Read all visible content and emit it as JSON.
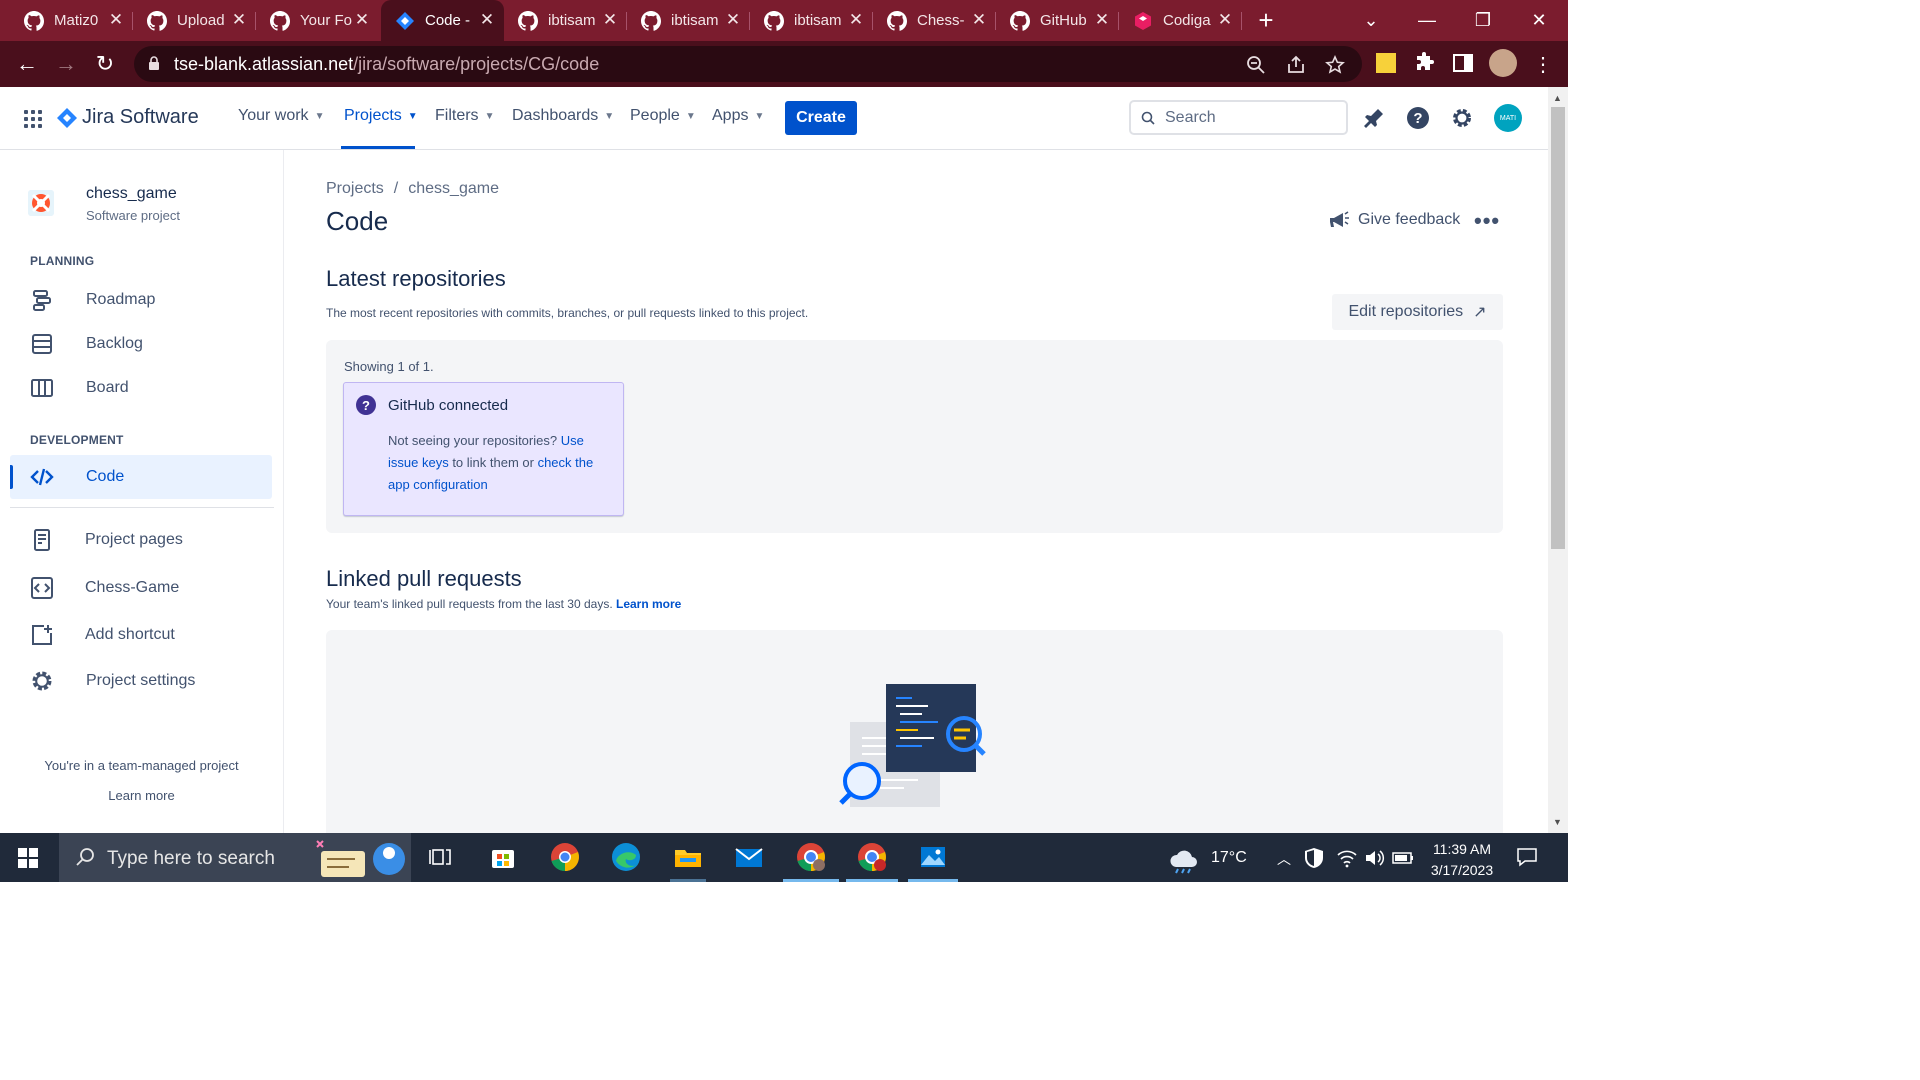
{
  "browser": {
    "tabs": [
      {
        "label": "Matiz0",
        "icon": "github-icon",
        "active": false
      },
      {
        "label": "Upload",
        "icon": "github-icon",
        "active": false
      },
      {
        "label": "Your Fo",
        "icon": "github-icon",
        "active": false
      },
      {
        "label": "Code -",
        "icon": "jira-icon",
        "active": true
      },
      {
        "label": "ibtisam",
        "icon": "github-icon",
        "active": false
      },
      {
        "label": "ibtisam",
        "icon": "github-icon",
        "active": false
      },
      {
        "label": "ibtisam",
        "icon": "github-icon",
        "active": false
      },
      {
        "label": "Chess-",
        "icon": "github-icon",
        "active": false
      },
      {
        "label": "GitHub",
        "icon": "github-icon",
        "active": false
      },
      {
        "label": "Codiga",
        "icon": "codiga-icon",
        "active": false
      }
    ],
    "url_host": "tse-blank.atlassian.net",
    "url_path": "/jira/software/projects/CG/code",
    "colors": {
      "tabbar": "#7b1c2e",
      "toolbar": "#4a0f1c"
    }
  },
  "jira": {
    "product_name": "Jira Software",
    "nav": [
      {
        "label": "Your work",
        "active": false
      },
      {
        "label": "Projects",
        "active": true
      },
      {
        "label": "Filters",
        "active": false
      },
      {
        "label": "Dashboards",
        "active": false
      },
      {
        "label": "People",
        "active": false
      },
      {
        "label": "Apps",
        "active": false
      }
    ],
    "create_label": "Create",
    "search_placeholder": "Search",
    "avatar_initials": "MATI",
    "accent": "#0052cc"
  },
  "sidebar": {
    "project_name": "chess_game",
    "project_type": "Software project",
    "planning_heading": "PLANNING",
    "planning_items": [
      {
        "label": "Roadmap",
        "icon": "roadmap-icon"
      },
      {
        "label": "Backlog",
        "icon": "backlog-icon"
      },
      {
        "label": "Board",
        "icon": "board-icon"
      }
    ],
    "development_heading": "DEVELOPMENT",
    "development_items": [
      {
        "label": "Code",
        "icon": "code-icon",
        "selected": true
      }
    ],
    "other_items": [
      {
        "label": "Project pages",
        "icon": "page-icon"
      },
      {
        "label": "Chess-Game",
        "icon": "code-shortcut-icon"
      },
      {
        "label": "Add shortcut",
        "icon": "add-shortcut-icon"
      },
      {
        "label": "Project settings",
        "icon": "gear-icon"
      }
    ],
    "team_note": "You're in a team-managed project",
    "team_learn_more": "Learn more"
  },
  "main": {
    "breadcrumb": [
      "Projects",
      "chess_game"
    ],
    "title": "Code",
    "feedback_label": "Give feedback",
    "more_label": "•••",
    "latest_repos": {
      "heading": "Latest repositories",
      "description": "The most recent repositories with commits, branches, or pull requests linked to this project.",
      "edit_label": "Edit repositories",
      "showing": "Showing 1 of 1.",
      "card_title": "GitHub connected",
      "card_text_1": "Not seeing your repositories? ",
      "card_link_1": "Use issue keys",
      "card_text_2": " to link them or ",
      "card_link_2": "check the app configuration"
    },
    "linked_prs": {
      "heading": "Linked pull requests",
      "description": "Your team's linked pull requests from the last 30 days. ",
      "learn_more": "Learn more"
    }
  },
  "taskbar": {
    "search_placeholder": "Type here to search",
    "apps": [
      "task-view-icon",
      "store-icon",
      "chrome-icon",
      "edge-icon",
      "file-explorer-icon",
      "mail-icon",
      "chrome-profile-icon",
      "chrome-profile-2-icon",
      "photos-icon"
    ],
    "weather": "17°C",
    "time": "11:39 AM",
    "date": "3/17/2023"
  }
}
